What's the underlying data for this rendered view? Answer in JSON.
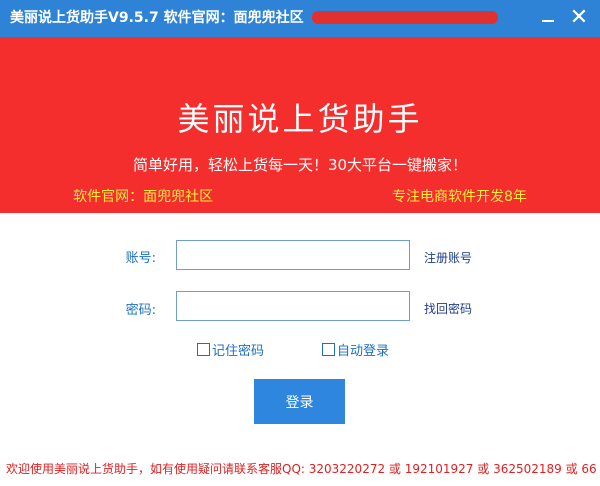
{
  "window": {
    "title": "美丽说上货助手V9.5.7  软件官网：面兜兜社区",
    "close_glyph": "✕",
    "colors": {
      "titlebar": "#2f83d6",
      "banner": "#f42d2d",
      "accent": "#2e86de"
    }
  },
  "banner": {
    "title": "美丽说上货助手",
    "slogan": "简单好用，轻松上货每一天！30大平台一键搬家！",
    "site_prefix": "软件官网：面兜兜社区",
    "site_suffix": "专注电商软件开发8年"
  },
  "form": {
    "account_label": "账号:",
    "account_value": "",
    "register_link": "注册账号",
    "password_label": "密码:",
    "password_value": "",
    "recover_link": "找回密码",
    "remember_label": "记住密码",
    "auto_login_label": "自动登录",
    "login_button": "登录"
  },
  "footer": {
    "message": "欢迎使用美丽说上货助手，如有使用疑问请联系客服QQ: 3203220272 或 192101927 或 362502189 或 66"
  }
}
